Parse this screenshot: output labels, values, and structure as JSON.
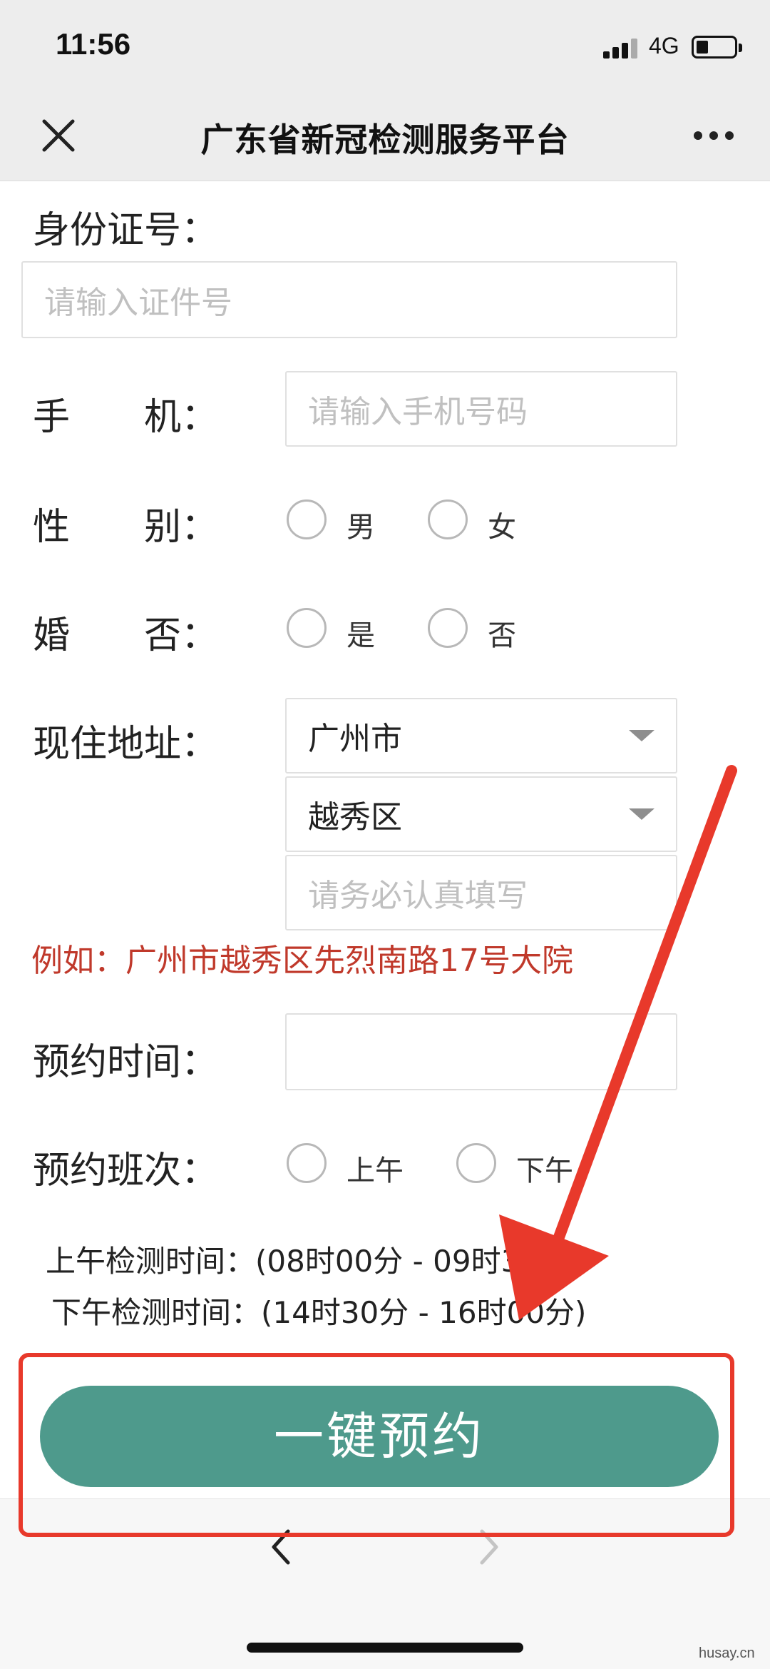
{
  "status_bar": {
    "time": "11:56",
    "network": "4G"
  },
  "nav": {
    "title": "广东省新冠检测服务平台"
  },
  "form": {
    "id_label": "身份证号：",
    "id_placeholder": "请输入证件号",
    "phone_label": "手　　机：",
    "phone_placeholder": "请输入手机号码",
    "gender_label": "性　　别：",
    "gender_options": [
      "男",
      "女"
    ],
    "married_label": "婚　　否：",
    "married_options": [
      "是",
      "否"
    ],
    "address_label": "现住地址：",
    "city_value": "广州市",
    "district_value": "越秀区",
    "address_placeholder": "请务必认真填写",
    "example_text": "例如：广州市越秀区先烈南路17号大院",
    "time_label": "预约时间：",
    "shift_label": "预约班次：",
    "shift_options": [
      "上午",
      "下午"
    ],
    "morning_info": "上午检测时间：(08时00分 - 09时30分)",
    "afternoon_info": "下午检测时间：(14时30分 - 16时00分)"
  },
  "action": {
    "book_label": "一键预约"
  },
  "watermark": "husay.cn",
  "colors": {
    "accent": "#4e9a8c",
    "annotation": "#e8392b",
    "example": "#c0392b"
  }
}
